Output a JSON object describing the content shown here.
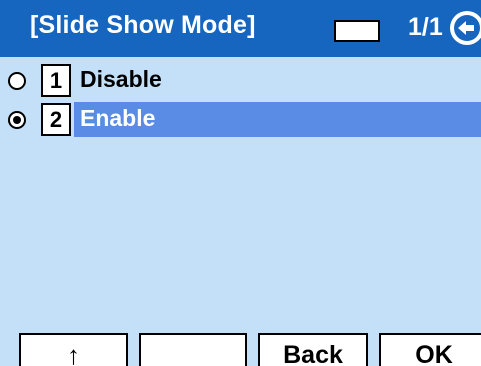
{
  "header": {
    "title": "[Slide Show Mode]",
    "page_indicator": "1/1",
    "back_icon": "back-arrow-icon"
  },
  "options": [
    {
      "number": "1",
      "label": "Disable",
      "selected": false
    },
    {
      "number": "2",
      "label": "Enable",
      "selected": true
    }
  ],
  "softkeys": {
    "key1_icon": "up-arrow-icon",
    "key1_glyph": "↑",
    "key2_label": "",
    "key3_label": "Back",
    "key4_label": "OK"
  },
  "colors": {
    "title_bar": "#1665bf",
    "background": "#c4e0f8",
    "selection": "#5a8ce6"
  }
}
